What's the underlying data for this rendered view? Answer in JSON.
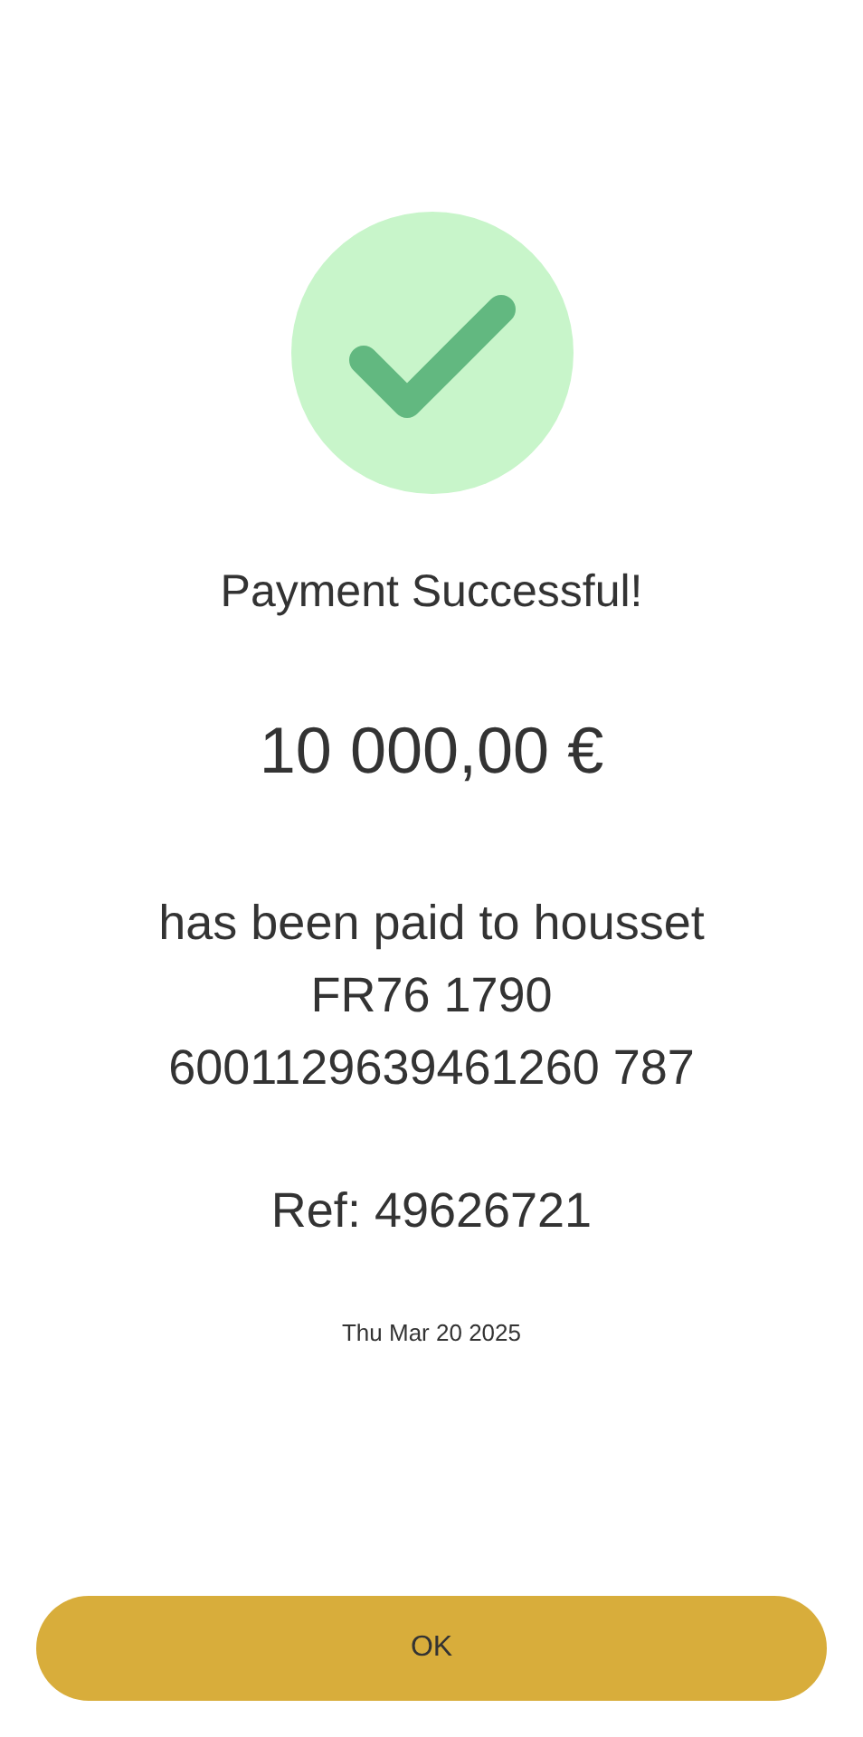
{
  "title": "Payment Successful!",
  "amount": "10 000,00 €",
  "recipient": "has been paid to housset FR76 1790 6001129639461260 787",
  "reference": "Ref: 49626721",
  "date": "Thu Mar 20 2025",
  "button": "OK"
}
